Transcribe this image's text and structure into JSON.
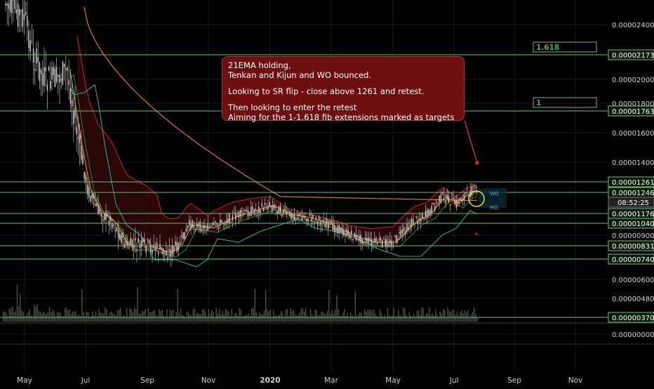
{
  "chart_data": {
    "type": "candlestick",
    "title": "",
    "xlabel": "",
    "ylabel": "",
    "x_tick_labels": [
      "May",
      "Jul",
      "Sep",
      "Nov",
      "2020",
      "Mar",
      "May",
      "Jul",
      "Sep",
      "Nov"
    ],
    "y_tick_labels": [
      "0.00002400",
      "0.00002000",
      "0.00001800",
      "0.00001600",
      "0.00001400",
      "0.00000900",
      "0.00000600",
      "0.00000480",
      "0.00000000"
    ],
    "ylim": [
      6e-06,
      2.5e-06
    ],
    "grid": true,
    "horizontal_levels": [
      {
        "label": "0.00002173",
        "value": 2.173e-05
      },
      {
        "label": "0.00001763",
        "value": 1.763e-05
      },
      {
        "label": "0.00001261",
        "value": 1.261e-05
      },
      {
        "label": "0.00001246",
        "value": 1.246e-05
      },
      {
        "label": "0.00001176",
        "value": 1.176e-05
      },
      {
        "label": "0.00001040",
        "value": 1.04e-05
      },
      {
        "label": "0.00000831",
        "value": 8.31e-06
      },
      {
        "label": "0.00000740",
        "value": 7.4e-06
      },
      {
        "label": "0.00000370",
        "value": 3.7e-06
      }
    ],
    "countdown_label": "08:52:25",
    "fib_labels": [
      {
        "text": "1.618",
        "level": "0.00002173"
      },
      {
        "text": "1",
        "level": "0.00001763"
      }
    ],
    "chart_labels": [
      "WO",
      "MO"
    ],
    "annotation": [
      "21EMA holding,",
      "Tenkan and Kijun and WO bounced.",
      "",
      "Looking to SR flip - close above 1261 and retest.",
      "",
      "Then looking to enter the retest",
      "Aiming for the 1-1.618 fib extensions marked as targets"
    ],
    "colors": {
      "background": "#000000",
      "levels": "#6fbf6f",
      "up_candle": "#d8d8d8",
      "down_candle": "#d8d8d8",
      "kumo": "#3a0a0a",
      "ma_orange": "#e0703a",
      "ma_red": "#c62828",
      "ma_teal": "#26a69a",
      "ma_green": "#2e7d32",
      "ema": "#e0b020",
      "annotation_bg": "#6e0f0f",
      "fib_text": "#4caf50"
    }
  }
}
